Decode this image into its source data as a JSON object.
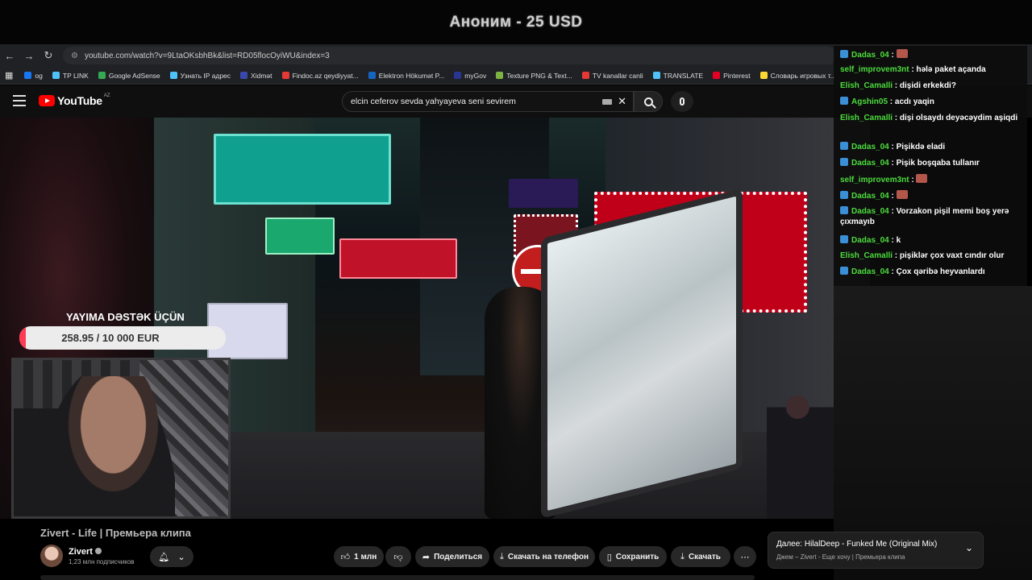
{
  "stream": {
    "title": "Аноним - 25 USD"
  },
  "browser": {
    "url": "youtube.com/watch?v=9LtaOKsbhBk&list=RD05flocOyiWU&index=3",
    "bookmarks": [
      {
        "label": "og",
        "color": "#1877f2"
      },
      {
        "label": "TP LINK",
        "color": "#4fc3f7"
      },
      {
        "label": "Google AdSense",
        "color": "#34a853"
      },
      {
        "label": "Узнать IP адрес",
        "color": "#4fc3f7"
      },
      {
        "label": "Xidmət",
        "color": "#3949ab"
      },
      {
        "label": "Findoc.az qeydiyyat...",
        "color": "#e53935"
      },
      {
        "label": "Elektron Hökumət P...",
        "color": "#1565c0"
      },
      {
        "label": "myGov",
        "color": "#283593"
      },
      {
        "label": "Texture PNG & Text...",
        "color": "#7cb342"
      },
      {
        "label": "TV kanallar canli",
        "color": "#e53935"
      },
      {
        "label": "TRANSLATE",
        "color": "#4fc3f7"
      },
      {
        "label": "Pinterest",
        "color": "#e60023"
      },
      {
        "label": "Словарь игровых т...",
        "color": "#fdd835"
      }
    ]
  },
  "youtube": {
    "logo_text": "YouTube",
    "region": "AZ",
    "search_value": "elcin ceferov sevda yahyayeva seni sevirem",
    "video_title": "Zivert - Life | Премьера клипа",
    "channel": {
      "name": "Zivert",
      "subscribers": "1,23 млн подписчиков"
    },
    "actions": {
      "like": "1 млн",
      "share": "Поделиться",
      "download_phone": "Скачать на телефон",
      "save": "Сохранить",
      "download": "Скачать"
    },
    "up_next": {
      "title": "Далее: HilalDeep - Funked Me (Original Mix)",
      "subtitle": "Джем – Zivert - Еще хочу | Премьера клипа"
    }
  },
  "donation": {
    "title": "YAYIMA DƏSTƏK ÜÇÜN",
    "amount_text": "258.95 / 10 000 EUR",
    "progress_fraction": 0.0259,
    "fill_color": "#ff3a52"
  },
  "chat": [
    {
      "user": "Dadas_04",
      "text": "",
      "emote": true,
      "badge": true
    },
    {
      "user": "self_improvem3nt",
      "text": "hələ paket açanda",
      "emote": false,
      "badge": false
    },
    {
      "user": "Elish_Camalli",
      "text": "dişidi erkekdi?",
      "emote": false,
      "badge": false
    },
    {
      "user": "Agshin05",
      "text": "acdı yaqin",
      "emote": false,
      "badge": true
    },
    {
      "user": "Elish_Camalli",
      "text": "dişi olsaydı deyəcəydim aşiqdi",
      "emote": false,
      "badge": false
    },
    {
      "user": "Dadas_04",
      "text": "Pişikdə eladi",
      "emote": false,
      "badge": true
    },
    {
      "user": "Dadas_04",
      "text": "Pişik boşqaba tullanır",
      "emote": false,
      "badge": true
    },
    {
      "user": "self_improvem3nt",
      "text": "",
      "emote": true,
      "badge": false
    },
    {
      "user": "Dadas_04",
      "text": "",
      "emote": true,
      "badge": true
    },
    {
      "user": "Dadas_04",
      "text": "Vorzakon pişil memi boş yerə çıxmayıb",
      "emote": false,
      "badge": true
    },
    {
      "user": "Dadas_04",
      "text": "k",
      "emote": false,
      "badge": true
    },
    {
      "user": "Elish_Camalli",
      "text": "pişiklər çox vaxt cındır olur",
      "emote": false,
      "badge": false
    },
    {
      "user": "Dadas_04",
      "text": "Çox qəribə heyvanlardı",
      "emote": false,
      "badge": true
    }
  ]
}
